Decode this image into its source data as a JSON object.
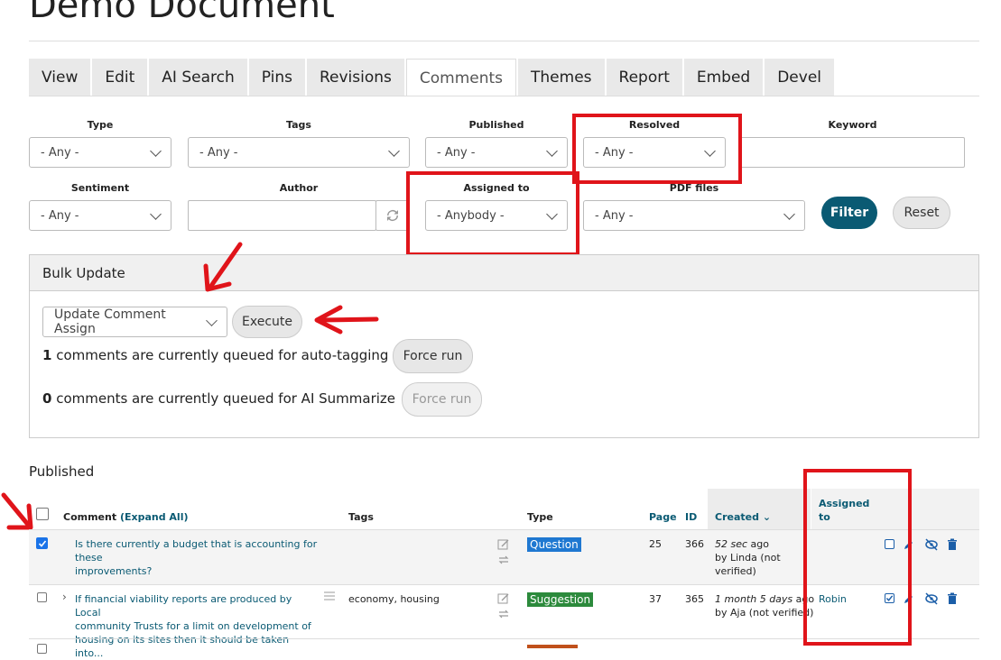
{
  "page": {
    "title": "Demo Document"
  },
  "tabs": [
    "View",
    "Edit",
    "AI Search",
    "Pins",
    "Revisions",
    "Comments",
    "Themes",
    "Report",
    "Embed",
    "Devel"
  ],
  "filters": {
    "type": {
      "label": "Type",
      "value": "- Any -"
    },
    "tags": {
      "label": "Tags",
      "value": "- Any -"
    },
    "published": {
      "label": "Published",
      "value": "- Any -"
    },
    "resolved": {
      "label": "Resolved",
      "value": "- Any -"
    },
    "keyword": {
      "label": "Keyword",
      "value": ""
    },
    "sentiment": {
      "label": "Sentiment",
      "value": "- Any -"
    },
    "author": {
      "label": "Author",
      "value": ""
    },
    "assigned": {
      "label": "Assigned to",
      "value": "- Anybody -"
    },
    "pdf": {
      "label": "PDF files",
      "value": "- Any -"
    },
    "filter_btn": "Filter",
    "reset_btn": "Reset"
  },
  "bulk": {
    "title": "Bulk Update",
    "action": "Update Comment Assign",
    "execute": "Execute",
    "q1_count": "1",
    "q1_text": " comments are currently queued for auto-tagging",
    "q1_btn": "Force run",
    "q2_count": "0",
    "q2_text": " comments are currently queued for AI Summarize",
    "q2_btn": "Force run"
  },
  "table": {
    "section": "Published",
    "headers": {
      "comment": "Comment",
      "expand": "(Expand All)",
      "tags": "Tags",
      "type": "Type",
      "page": "Page",
      "id": "ID",
      "created": "Created",
      "assigned1": "Assigned",
      "assigned2": "to"
    },
    "rows": [
      {
        "comment1": "Is there currently a budget that is accounting for these",
        "comment2": "improvements?",
        "comment3": "",
        "tags": "",
        "type": "Question",
        "type_color": "#1f78d1",
        "page": "25",
        "id": "366",
        "created1": "52 sec",
        "created1b": " ago",
        "created2": "by Linda (not",
        "created3": "verified)",
        "assigned": ""
      },
      {
        "comment1": "If financial viability reports are produced by Local",
        "comment2": "community Trusts for a limit on development of",
        "comment3": "housing on its sites then it should be taken into...",
        "tags": "economy, housing",
        "type": "Suggestion",
        "type_color": "#2c8a3c",
        "page": "37",
        "id": "365",
        "created1": "1 month 5 days",
        "created1b": " ago",
        "created2": "by Aja (not verified)",
        "created3": "",
        "assigned": "Robin"
      }
    ]
  },
  "colors": {
    "accent": "#0a5a73",
    "annotation": "#e0141a"
  }
}
